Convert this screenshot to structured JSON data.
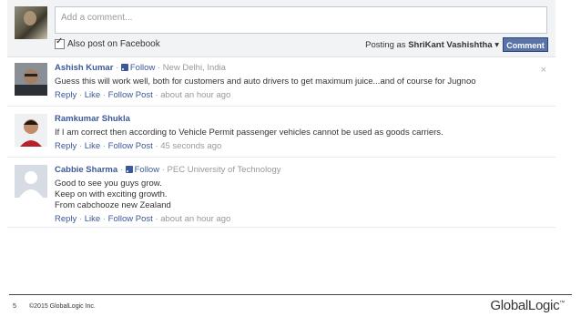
{
  "composer": {
    "placeholder": "Add a comment...",
    "also_post_label": "Also post on Facebook",
    "posting_as_prefix": "Posting as",
    "posting_as_name": "ShriKant Vashishtha",
    "posting_as_caret": "▾",
    "submit_label": "Comment"
  },
  "comments": [
    {
      "name": "Ashish Kumar",
      "follow": "Follow",
      "location": "New Delhi, India",
      "text": "Guess this will work well, both for customers and auto drivers to get maximum juice...and of course for Jugnoo",
      "reply": "Reply",
      "like": "Like",
      "follow_post": "Follow Post",
      "time": "about an hour ago"
    },
    {
      "name": "Ramkumar Shukla",
      "text": "If I am correct then according to Vehicle Permit passenger vehicles cannot be used as goods carriers.",
      "reply": "Reply",
      "like": "Like",
      "follow_post": "Follow Post",
      "time": "45 seconds ago"
    },
    {
      "name": "Cabbie Sharma",
      "follow": "Follow",
      "location": "PEC University of Technology",
      "text_lines": [
        "Good to see you guys grow.",
        "Keep on with exciting growth.",
        "From cabchooze new Zealand"
      ],
      "reply": "Reply",
      "like": "Like",
      "follow_post": "Follow Post",
      "time": "about an hour ago"
    }
  ],
  "close_glyph": "×",
  "footer": {
    "page_number": "5",
    "copyright": "©2015 GlobalLogic Inc.",
    "logo": "GlobalLogic",
    "logo_mark": "™"
  },
  "colors": {
    "link": "#3b5998",
    "button": "#5b74a8",
    "composer_bg": "#f2f3f5"
  }
}
